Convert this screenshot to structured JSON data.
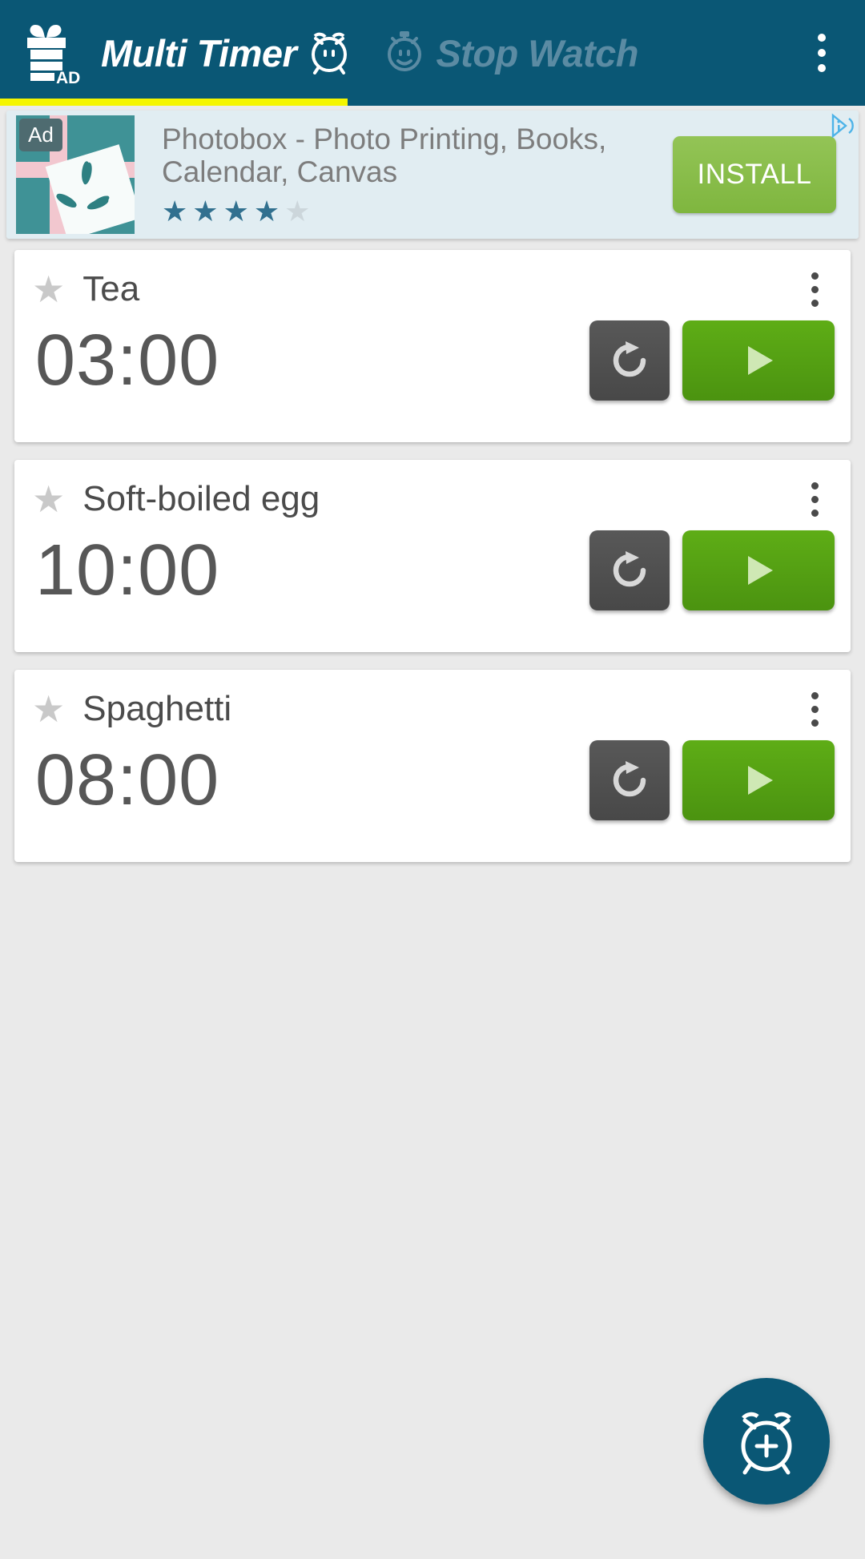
{
  "appbar": {
    "ad_logo_icon": "ad-gift-icon",
    "ad_logo_label": "AD",
    "tabs": [
      {
        "label": "Multi Timer",
        "icon": "alarm-clock-icon",
        "active": true
      },
      {
        "label": "Stop Watch",
        "icon": "stopwatch-icon",
        "active": false
      }
    ],
    "overflow_icon": "overflow-menu-icon",
    "accent_color": "#0a5775",
    "underline_color": "#f5f500"
  },
  "ad": {
    "badge": "Ad",
    "title": "Photobox - Photo Printing, Books, Calendar, Canvas",
    "install_label": "INSTALL",
    "rating": 4,
    "rating_max": 5,
    "star_filled_color": "#31708f",
    "star_empty_color": "#ccd6db",
    "adchoices_icon": "adchoices-icon",
    "thumbnail_icon": "gift-photo-thumbnail",
    "install_color": "#86bb4a",
    "background_color": "#e1edf2"
  },
  "timers": [
    {
      "name": "Tea",
      "time": "03:00",
      "favorite": false,
      "star_icon": "star-icon",
      "menu_icon": "overflow-menu-icon",
      "reset_icon": "reset-icon",
      "play_icon": "play-icon"
    },
    {
      "name": "Soft-boiled egg",
      "time": "10:00",
      "favorite": false,
      "star_icon": "star-icon",
      "menu_icon": "overflow-menu-icon",
      "reset_icon": "reset-icon",
      "play_icon": "play-icon"
    },
    {
      "name": "Spaghetti",
      "time": "08:00",
      "favorite": false,
      "star_icon": "star-icon",
      "menu_icon": "overflow-menu-icon",
      "reset_icon": "reset-icon",
      "play_icon": "play-icon"
    }
  ],
  "fab": {
    "icon": "add-alarm-icon",
    "color": "#0a5775"
  },
  "icons": {
    "star_glyph": "★"
  }
}
